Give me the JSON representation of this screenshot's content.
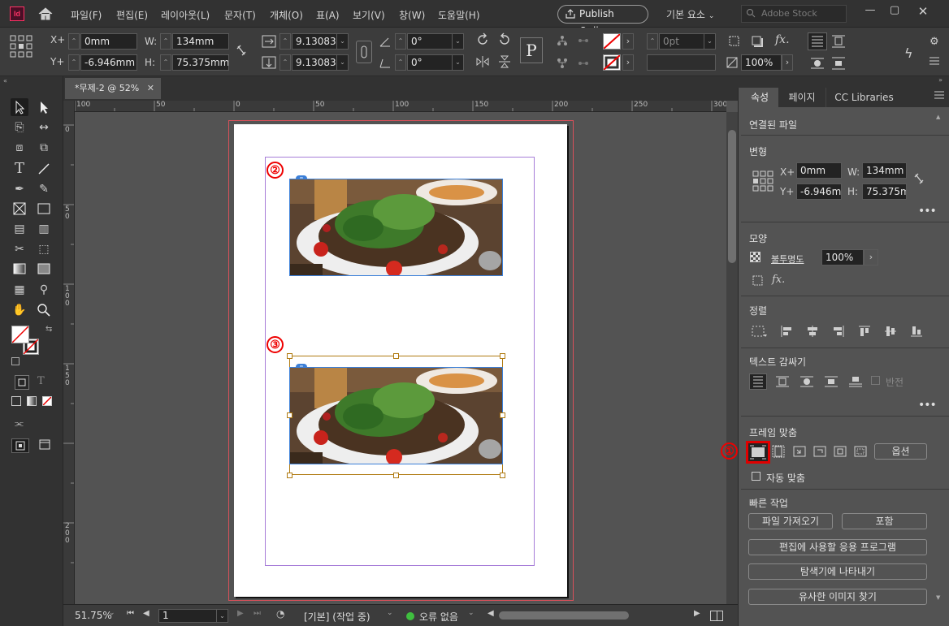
{
  "app": {
    "logo": "Id"
  },
  "menu": [
    "파일(F)",
    "편집(E)",
    "레이아웃(L)",
    "문자(T)",
    "개체(O)",
    "표(A)",
    "보기(V)",
    "창(W)",
    "도움말(H)"
  ],
  "publish_label": "Publish Online",
  "workspace_label": "기본 요소",
  "stock_placeholder": "Adobe Stock",
  "control": {
    "x_label": "X+",
    "y_label": "Y+",
    "w_label": "W:",
    "h_label": "H:",
    "x": "0mm",
    "y": "-6.946mm",
    "w": "134mm",
    "h": "75.375mm",
    "scale_x": "9.13083",
    "scale_y": "9.13083",
    "rotate": "0°",
    "shear": "0°",
    "stroke": "0pt",
    "opacity": "100%"
  },
  "doc_tab": "*무제-2 @ 52%",
  "ruler_h": [
    "100",
    "50",
    "0",
    "50",
    "100",
    "150",
    "200",
    "250",
    "300"
  ],
  "ruler_v": [
    "0",
    "5 0",
    "1 0 0",
    "1 5 0",
    "2 0 0"
  ],
  "badges": {
    "one": "①",
    "two": "②",
    "three": "③"
  },
  "status": {
    "zoom": "51.75%",
    "page": "1",
    "master": "[기본] (작업 중)",
    "errors": "오류 없음"
  },
  "panel": {
    "tabs": [
      "속성",
      "페이지",
      "CC Libraries"
    ],
    "linked_file": "연결된 파일",
    "transform_title": "변형",
    "x_label": "X+",
    "y_label": "Y+",
    "w_label": "W:",
    "h_label": "H:",
    "x": "0mm",
    "y": "-6.946m",
    "w": "134mm",
    "h": "75.375m",
    "appearance_title": "모양",
    "opacity_label": "불투명도",
    "opacity": "100%",
    "align_title": "정렬",
    "wrap_title": "텍스트 감싸기",
    "invert_label": "반전",
    "fit_title": "프레임 맞춤",
    "options_label": "옵션",
    "autofit_label": "자동 맞춤",
    "quick_title": "빠른 작업",
    "import_label": "파일 가져오기",
    "embed_label": "포함",
    "edit_with_label": "편집에 사용할 응용 프로그램",
    "reveal_label": "탐색기에 나타내기",
    "similar_label": "유사한 이미지 찾기"
  },
  "colors": {
    "accent": "#e00000",
    "bleed": "#d8505a",
    "margin": "#a77dd8",
    "frame": "#b07a10",
    "selection": "#3b7fd8"
  }
}
